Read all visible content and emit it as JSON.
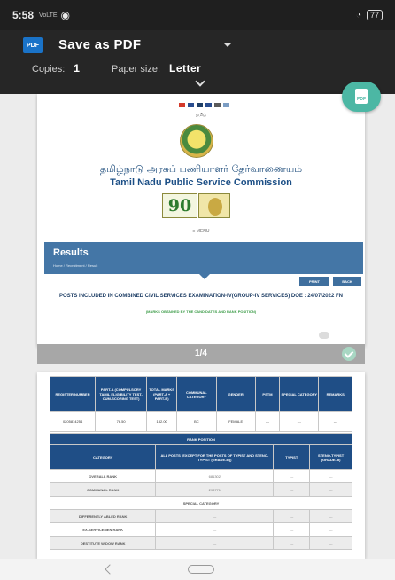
{
  "status_bar": {
    "time": "5:58",
    "signal_text": "VoLTE",
    "battery": "77"
  },
  "pdf_bar": {
    "icon_label": "PDF",
    "title": "Save as PDF",
    "copies_label": "Copies:",
    "copies_value": "1",
    "paper_size_label": "Paper size:",
    "paper_size_value": "Letter"
  },
  "fab": {
    "icon_label": "PDF"
  },
  "page1": {
    "site_small": "தமிழ்",
    "tamil_name": "தமிழ்நாடு அரசுப் பணியாளர் தேர்வாணையம்",
    "english_name": "Tamil Nadu Public Service Commission",
    "ninety": "90",
    "menu_label": "≡ MENU",
    "results_title": "Results",
    "breadcrumb": "Home / Recruitment / Result",
    "print_label": "PRINT",
    "back_label": "BACK",
    "posts_heading": "POSTS INCLUDED IN COMBINED CIVIL SERVICES EXAMINATION-IV(GROUP-IV SERVICES) DOE : 24/07/2022 FN",
    "marks_note": "(MARKS OBTAINED BY THE CANDIDATES AND RANK POSITION)"
  },
  "page_indicator": {
    "count": "1/4"
  },
  "page2": {
    "table1": {
      "headers": [
        "REGISTER NUMBER",
        "PART-A (COMPULSORY TAMIL ELIGIBILITY TEST-CUM-SCORING TEST)",
        "TOTAL MARKS (PART-A + PART-B)",
        "COMMUNAL CATEGORY",
        "GENDER",
        "PSTM",
        "SPECIAL CATEGORY",
        "REMARKS"
      ],
      "row": [
        "0205814254",
        "76.50",
        "132.00",
        "BC",
        "FEMALE",
        "---",
        "---",
        "---"
      ]
    },
    "table2": {
      "rank_position": "RANK POSITION",
      "col_category": "CATEGORY",
      "col_all_posts": "ALL POSTS (EXCEPT FOR THE POSTS OF TYPIST AND STENO-TYPIST (GRADE-III))",
      "col_typist": "TYPIST",
      "col_steno": "STENO-TYPIST (GRADE-III)",
      "rows": [
        {
          "label": "OVERALL RANK",
          "all": "681302",
          "typist": "---",
          "steno": "---"
        },
        {
          "label": "COMMUNAL RANK",
          "all": "298771",
          "typist": "---",
          "steno": "---"
        }
      ],
      "special_category": "SPECIAL CATEGORY",
      "special_rows": [
        {
          "label": "DIFFERENTLY ABLED RANK",
          "all": "---",
          "typist": "---",
          "steno": "---"
        },
        {
          "label": "EX-SERVICEMEN RANK",
          "all": "---",
          "typist": "---",
          "steno": "---"
        },
        {
          "label": "DESTITUTE WIDOW RANK",
          "all": "---",
          "typist": "---",
          "steno": "---"
        }
      ]
    }
  },
  "colors": {
    "accent": "#4476a6",
    "header_blue": "#1f4e86",
    "fab": "#4cb7a4",
    "success_green": "#3b9b47"
  }
}
